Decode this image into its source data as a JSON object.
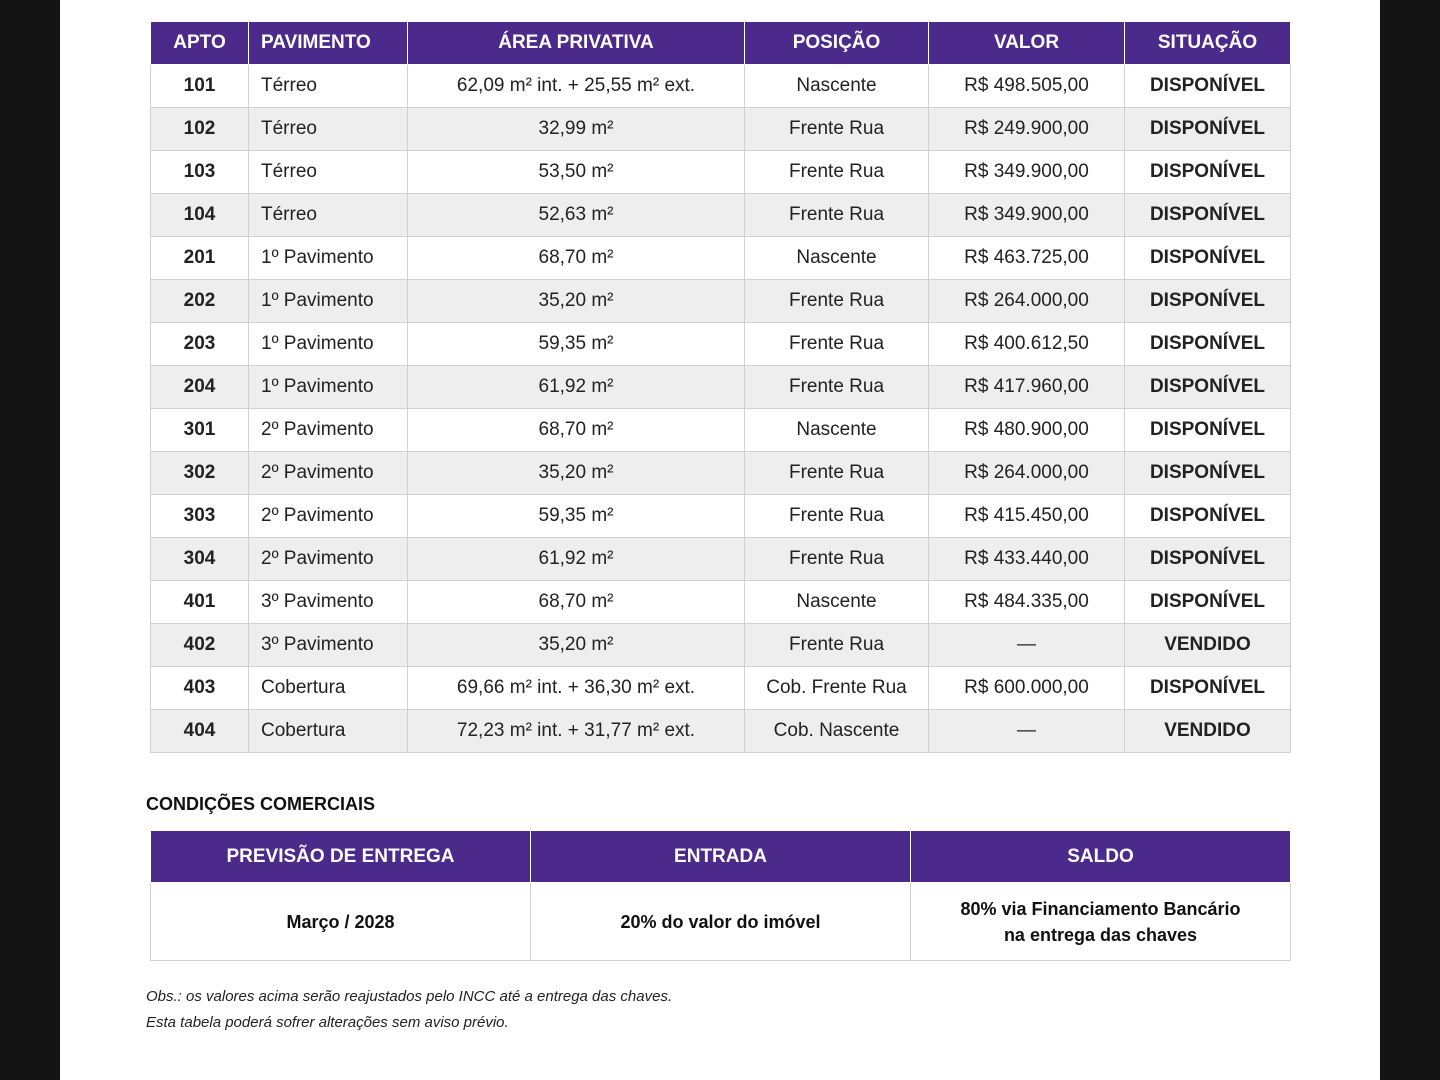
{
  "units_table": {
    "headers": [
      "APTO",
      "PAVIMENTO",
      "ÁREA PRIVATIVA",
      "POSIÇÃO",
      "VALOR",
      "SITUAÇÃO"
    ],
    "rows": [
      {
        "apto": "101",
        "pavimento": "Térreo",
        "area": "62,09 m² int. + 25,55 m² ext.",
        "posicao": "Nascente",
        "valor": "R$ 498.505,00",
        "situacao": "DISPONÍVEL"
      },
      {
        "apto": "102",
        "pavimento": "Térreo",
        "area": "32,99 m²",
        "posicao": "Frente Rua",
        "valor": "R$ 249.900,00",
        "situacao": "DISPONÍVEL"
      },
      {
        "apto": "103",
        "pavimento": "Térreo",
        "area": "53,50 m²",
        "posicao": "Frente Rua",
        "valor": "R$ 349.900,00",
        "situacao": "DISPONÍVEL"
      },
      {
        "apto": "104",
        "pavimento": "Térreo",
        "area": "52,63 m²",
        "posicao": "Frente Rua",
        "valor": "R$ 349.900,00",
        "situacao": "DISPONÍVEL"
      },
      {
        "apto": "201",
        "pavimento": "1º Pavimento",
        "area": "68,70 m²",
        "posicao": "Nascente",
        "valor": "R$ 463.725,00",
        "situacao": "DISPONÍVEL"
      },
      {
        "apto": "202",
        "pavimento": "1º Pavimento",
        "area": "35,20 m²",
        "posicao": "Frente Rua",
        "valor": "R$ 264.000,00",
        "situacao": "DISPONÍVEL"
      },
      {
        "apto": "203",
        "pavimento": "1º Pavimento",
        "area": "59,35 m²",
        "posicao": "Frente Rua",
        "valor": "R$ 400.612,50",
        "situacao": "DISPONÍVEL"
      },
      {
        "apto": "204",
        "pavimento": "1º Pavimento",
        "area": "61,92 m²",
        "posicao": "Frente Rua",
        "valor": "R$ 417.960,00",
        "situacao": "DISPONÍVEL"
      },
      {
        "apto": "301",
        "pavimento": "2º Pavimento",
        "area": "68,70 m²",
        "posicao": "Nascente",
        "valor": "R$ 480.900,00",
        "situacao": "DISPONÍVEL"
      },
      {
        "apto": "302",
        "pavimento": "2º Pavimento",
        "area": "35,20 m²",
        "posicao": "Frente Rua",
        "valor": "R$ 264.000,00",
        "situacao": "DISPONÍVEL"
      },
      {
        "apto": "303",
        "pavimento": "2º Pavimento",
        "area": "59,35 m²",
        "posicao": "Frente Rua",
        "valor": "R$ 415.450,00",
        "situacao": "DISPONÍVEL"
      },
      {
        "apto": "304",
        "pavimento": "2º Pavimento",
        "area": "61,92 m²",
        "posicao": "Frente Rua",
        "valor": "R$ 433.440,00",
        "situacao": "DISPONÍVEL"
      },
      {
        "apto": "401",
        "pavimento": "3º Pavimento",
        "area": "68,70 m²",
        "posicao": "Nascente",
        "valor": "R$ 484.335,00",
        "situacao": "DISPONÍVEL"
      },
      {
        "apto": "402",
        "pavimento": "3º Pavimento",
        "area": "35,20 m²",
        "posicao": "Frente Rua",
        "valor": "—",
        "situacao": "VENDIDO"
      },
      {
        "apto": "403",
        "pavimento": "Cobertura",
        "area": "69,66 m² int. + 36,30 m² ext.",
        "posicao": "Cob. Frente Rua",
        "valor": "R$ 600.000,00",
        "situacao": "DISPONÍVEL"
      },
      {
        "apto": "404",
        "pavimento": "Cobertura",
        "area": "72,23 m² int. + 31,77 m² ext.",
        "posicao": "Cob. Nascente",
        "valor": "—",
        "situacao": "VENDIDO"
      }
    ]
  },
  "conditions": {
    "title": "CONDIÇÕES COMERCIAIS",
    "headers": [
      "PREVISÃO DE ENTREGA",
      "ENTRADA",
      "SALDO"
    ],
    "values": {
      "entrega": "Março / 2028",
      "entrada": "20% do valor do imóvel",
      "saldo_line1": "80% via Financiamento Bancário",
      "saldo_line2": "na entrega das chaves"
    }
  },
  "notes": {
    "line1": "Obs.: os valores acima serão reajustados pelo INCC até a entrega das chaves.",
    "line2": "Esta tabela poderá sofrer alterações sem aviso prévio."
  },
  "colors": {
    "header_purple": "#4b2a8c",
    "available_green": "#2e9a45",
    "sold_red": "#d1272b"
  }
}
